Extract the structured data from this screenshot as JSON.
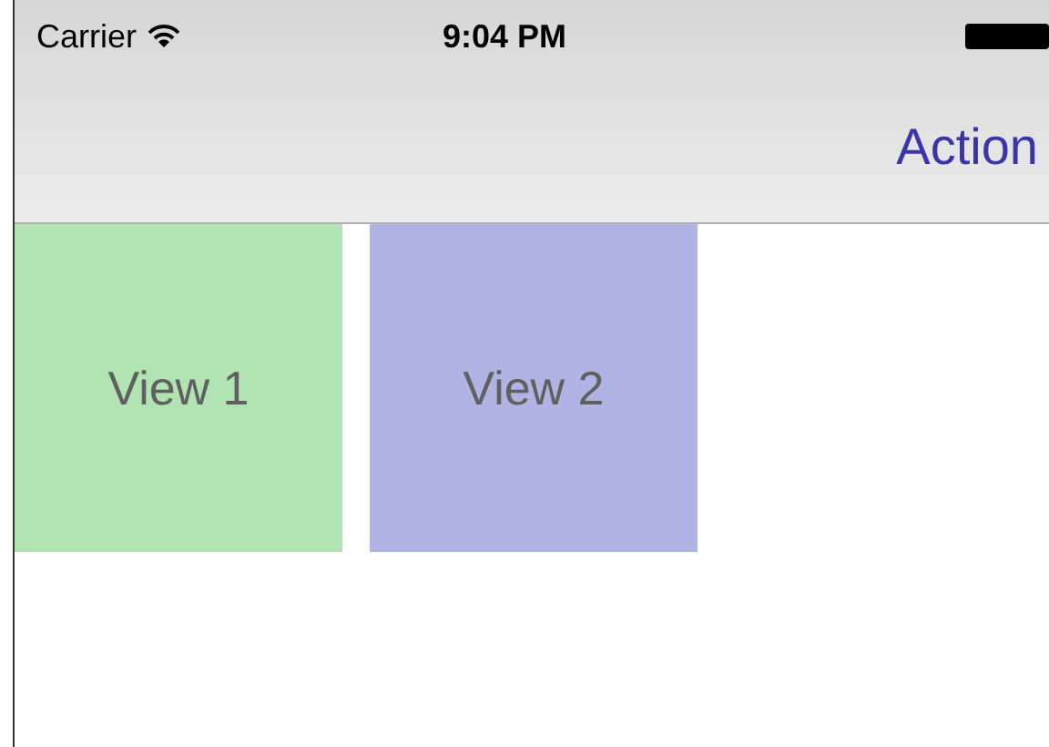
{
  "status_bar": {
    "carrier": "Carrier",
    "time": "9:04 PM"
  },
  "nav_bar": {
    "action": "Action"
  },
  "views": [
    {
      "label": "View 1",
      "color": "#b2e3b2"
    },
    {
      "label": "View 2",
      "color": "#b0b4e4"
    }
  ]
}
